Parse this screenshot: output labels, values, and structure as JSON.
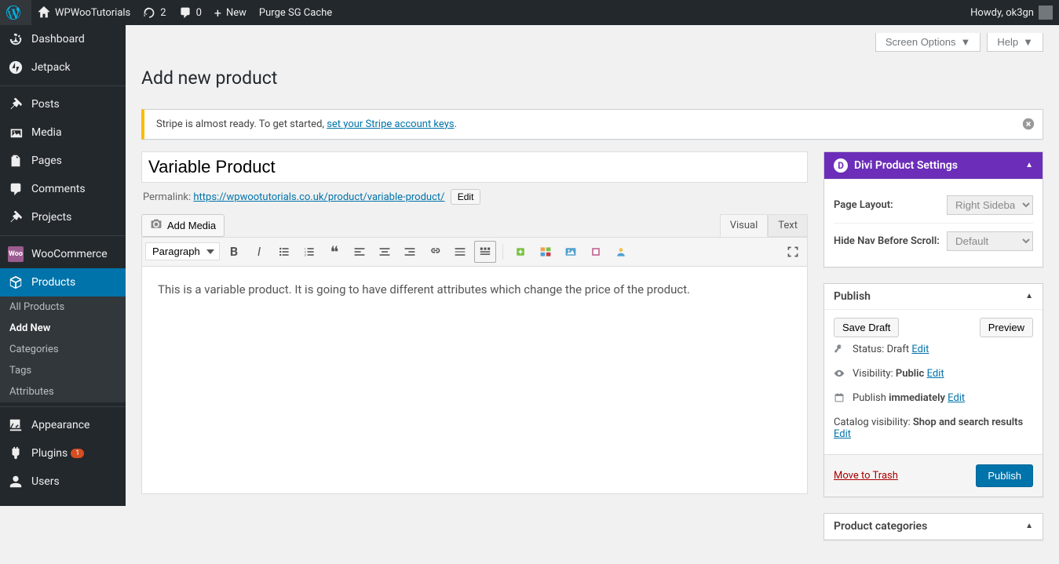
{
  "adminbar": {
    "site_name": "WPWooTutorials",
    "updates": "2",
    "comments": "0",
    "new": "New",
    "purge": "Purge SG Cache",
    "howdy": "Howdy, ok3gn"
  },
  "sidebar": {
    "items": [
      {
        "label": "Dashboard"
      },
      {
        "label": "Jetpack"
      },
      {
        "label": "Posts"
      },
      {
        "label": "Media"
      },
      {
        "label": "Pages"
      },
      {
        "label": "Comments"
      },
      {
        "label": "Projects"
      },
      {
        "label": "WooCommerce"
      },
      {
        "label": "Products"
      },
      {
        "label": "Appearance"
      },
      {
        "label": "Plugins"
      },
      {
        "label": "Users"
      }
    ],
    "plugins_badge": "1",
    "submenu": {
      "all_products": "All Products",
      "add_new": "Add New",
      "categories": "Categories",
      "tags": "Tags",
      "attributes": "Attributes"
    }
  },
  "page": {
    "title": "Add new product",
    "screen_options": "Screen Options",
    "help": "Help"
  },
  "notice": {
    "text_before": "Stripe is almost ready. To get started, ",
    "link": "set your Stripe account keys",
    "text_after": "."
  },
  "product": {
    "title": "Variable Product",
    "permalink_label": "Permalink:",
    "permalink": "https://wpwootutorials.co.uk/product/variable-product/",
    "edit": "Edit"
  },
  "editor": {
    "add_media": "Add Media",
    "tab_visual": "Visual",
    "tab_text": "Text",
    "paragraph": "Paragraph",
    "content": "This is a variable product. It is going to have different attributes which change the price of the product."
  },
  "divi": {
    "title": "Divi Product Settings",
    "page_layout_label": "Page Layout:",
    "page_layout_value": "Right Sidebar",
    "hide_nav_label": "Hide Nav Before Scroll:",
    "hide_nav_value": "Default"
  },
  "publish": {
    "title": "Publish",
    "save_draft": "Save Draft",
    "preview": "Preview",
    "status_label": "Status:",
    "status_value": "Draft",
    "visibility_label": "Visibility:",
    "visibility_value": "Public",
    "publish_label": "Publish",
    "publish_value": "immediately",
    "catalog_label": "Catalog visibility:",
    "catalog_value": "Shop and search results",
    "edit": "Edit",
    "move_trash": "Move to Trash",
    "publish_btn": "Publish"
  },
  "categories": {
    "title": "Product categories"
  }
}
